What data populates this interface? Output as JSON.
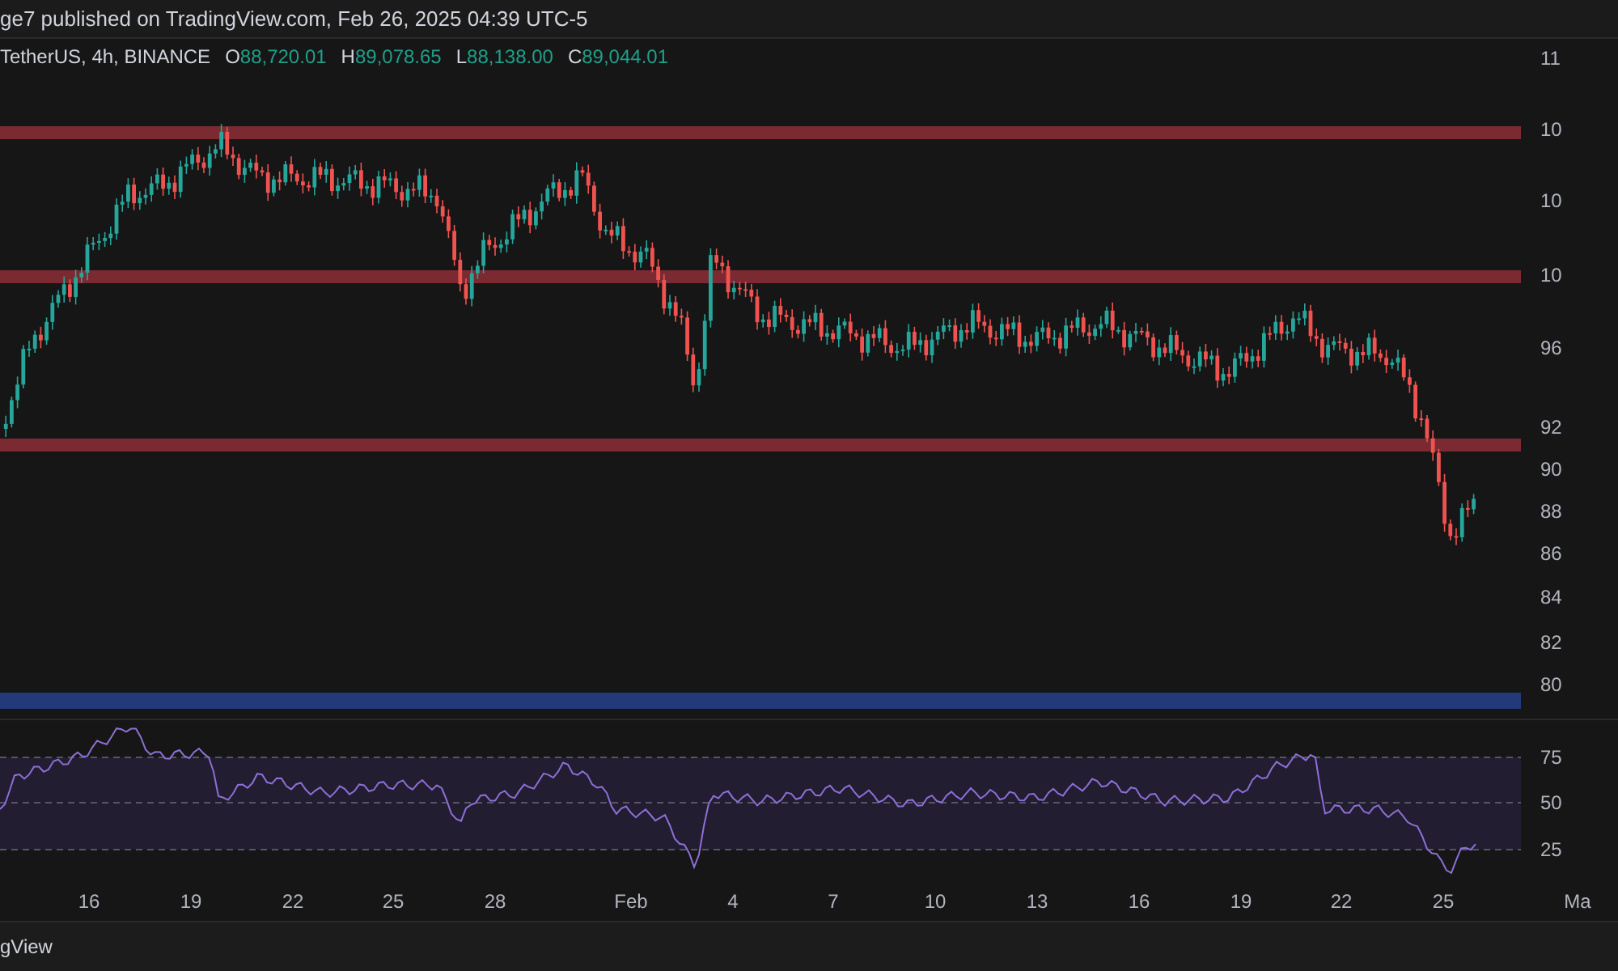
{
  "header": {
    "text": "ge7 published on TradingView.com, Feb 26, 2025 04:39 UTC-5"
  },
  "legend": {
    "symbol": "TetherUS, 4h, BINANCE",
    "ohlc": [
      {
        "label": "O",
        "value": "88,720.01"
      },
      {
        "label": "H",
        "value": "89,078.65"
      },
      {
        "label": "L",
        "value": "88,138.00"
      },
      {
        "label": "C",
        "value": "89,044.01"
      }
    ]
  },
  "price_axis": [
    "11",
    "10",
    "10",
    "10",
    "96",
    "92",
    "90",
    "88",
    "86",
    "84",
    "82",
    "80"
  ],
  "rsi_axis": [
    "75",
    "50",
    "25"
  ],
  "time_axis": [
    "16",
    "19",
    "22",
    "25",
    "28",
    "Feb",
    "4",
    "7",
    "10",
    "13",
    "16",
    "19",
    "22",
    "25",
    "Ma"
  ],
  "footer": {
    "text": "gView"
  }
}
